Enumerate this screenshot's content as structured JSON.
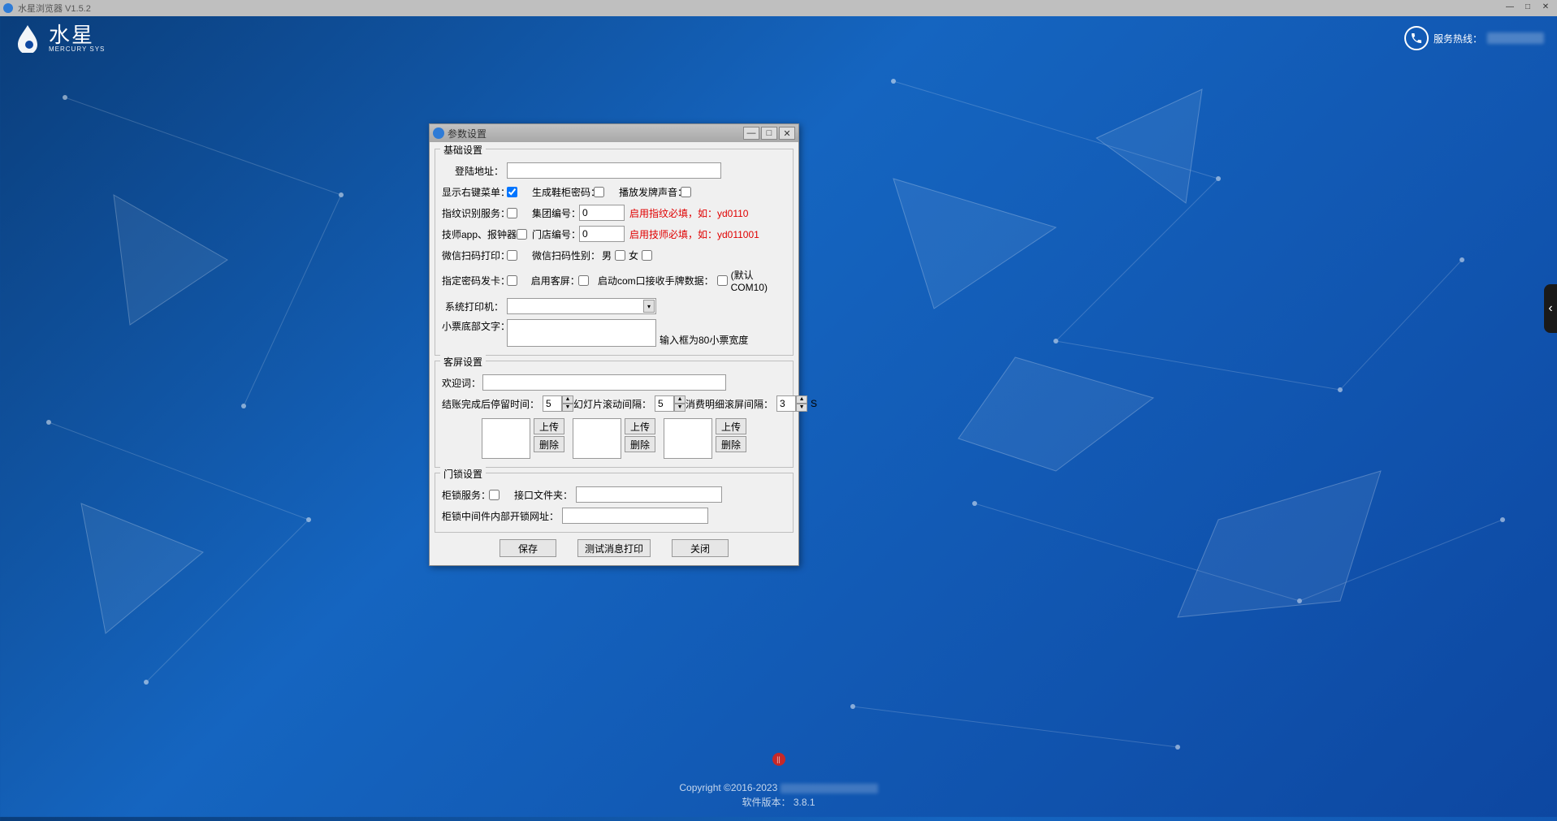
{
  "outer_window": {
    "title": "水星浏览器 V1.5.2"
  },
  "header": {
    "brand_zh": "水星",
    "brand_en": "MERCURY SYS",
    "hotline_label": "服务热线："
  },
  "dialog": {
    "title": "参数设置",
    "group_basic": {
      "title": "基础设置",
      "login_addr_label": "登陆地址：",
      "login_addr_value": "",
      "show_right_menu_label": "显示右键菜单：",
      "show_right_menu_checked": true,
      "gen_cabinet_pwd_label": "生成鞋柜密码：",
      "gen_cabinet_pwd_checked": false,
      "play_card_sound_label": "播放发牌声音：",
      "play_card_sound_checked": false,
      "fingerprint_label": "指纹识别服务：",
      "fingerprint_checked": false,
      "group_no_label": "集团编号：",
      "group_no_value": "0",
      "group_no_hint": "启用指纹必填，如：yd0110",
      "tech_app_label": "技师app、报钟器：",
      "tech_app_checked": false,
      "store_no_label": "门店编号：",
      "store_no_value": "0",
      "store_no_hint": "启用技师必填，如：yd011001",
      "wechat_print_label": "微信扫码打印：",
      "wechat_print_checked": false,
      "wechat_gender_label": "微信扫码性别：",
      "gender_male": "男",
      "gender_female": "女",
      "pwd_card_label": "指定密码发卡：",
      "pwd_card_checked": false,
      "enable_guest_screen_label": "启用客屏：",
      "enable_guest_screen_checked": false,
      "com_port_label": "启动com口接收手牌数据：",
      "com_port_checked": false,
      "com_default": "(默认COM10)",
      "printer_label": "系统打印机：",
      "printer_value": "",
      "ticket_footer_label": "小票底部文字：",
      "ticket_footer_value": "",
      "ticket_hint": "输入框为80小票宽度"
    },
    "group_guest": {
      "title": "客屏设置",
      "welcome_label": "欢迎词：",
      "welcome_value": "",
      "stay_after_checkout_label": "结账完成后停留时间：",
      "stay_after_checkout_value": "5",
      "slide_interval_label": "幻灯片滚动间隔：",
      "slide_interval_value": "5",
      "detail_scroll_label": "消费明细滚屏间隔：",
      "detail_scroll_value": "3",
      "unit_s": "S",
      "upload_btn": "上传",
      "delete_btn": "删除"
    },
    "group_lock": {
      "title": "门锁设置",
      "cabinet_service_label": "柜锁服务：",
      "cabinet_service_checked": false,
      "interface_folder_label": "接口文件夹：",
      "interface_folder_value": "",
      "middleware_url_label": "柜锁中间件内部开锁网址：",
      "middleware_url_value": ""
    },
    "buttons": {
      "save": "保存",
      "test_print": "测试消息打印",
      "close": "关闭"
    }
  },
  "footer": {
    "copyright": "Copyright ©2016-2023",
    "version_label": "软件版本：",
    "version": "3.8.1"
  }
}
